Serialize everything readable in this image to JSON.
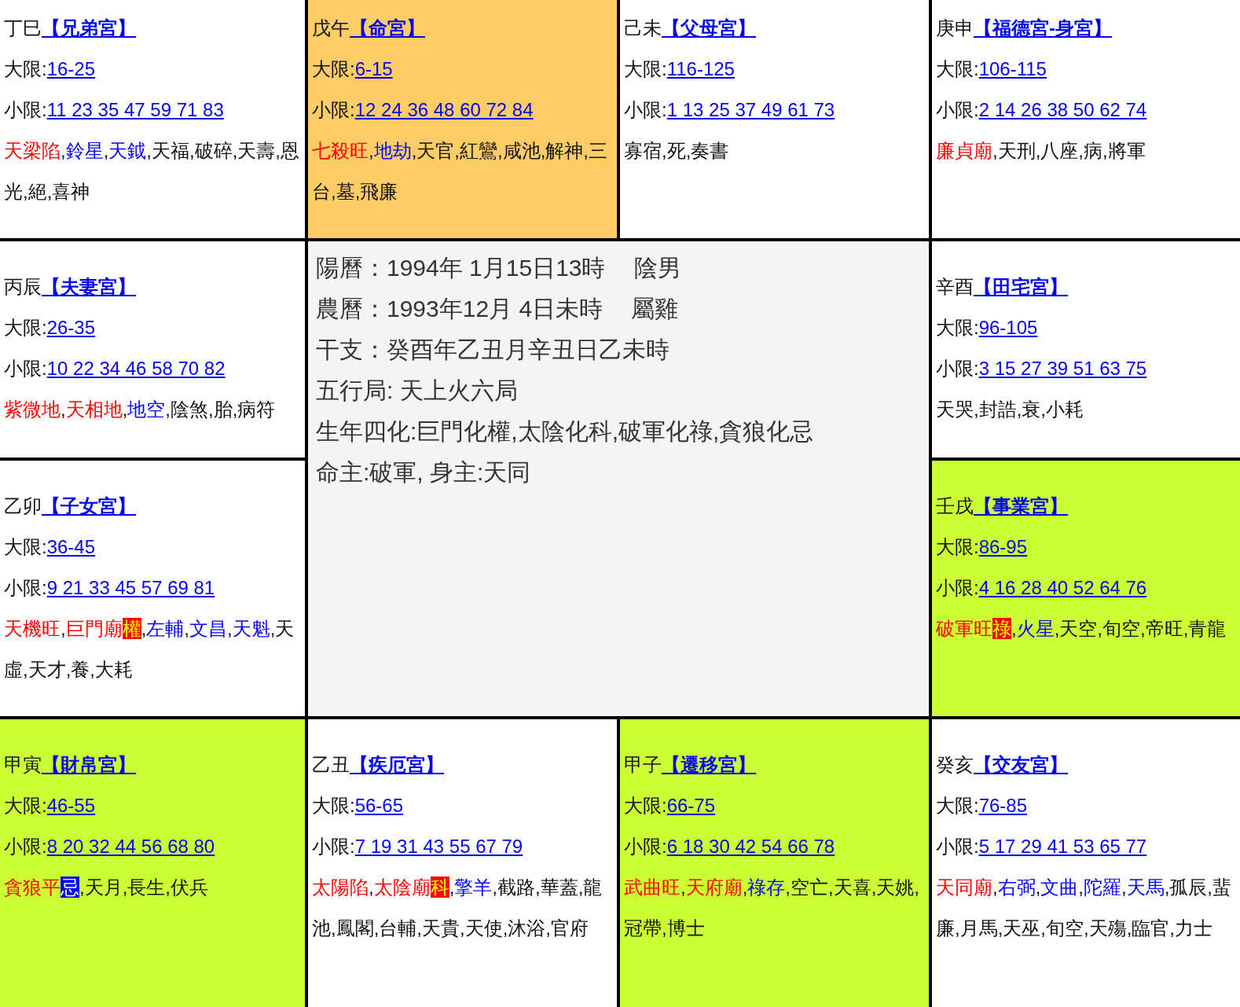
{
  "separator": ",",
  "palaces": [
    {
      "stem": "丁巳",
      "name": "【兄弟宮】",
      "color": "#ffffff",
      "major_limit": {
        "label": "大限:",
        "value": "16-25"
      },
      "minor_limit": {
        "label": "小限:",
        "value": "11 23 35 47 59 71 83"
      },
      "stars": [
        {
          "name": "天梁陷",
          "kind": "major"
        },
        {
          "name": "鈴星",
          "kind": "minor"
        },
        {
          "name": "天鉞",
          "kind": "minor"
        },
        {
          "name": "天福",
          "kind": "other"
        },
        {
          "name": "破碎",
          "kind": "other"
        },
        {
          "name": "天壽",
          "kind": "other"
        },
        {
          "name": "恩光",
          "kind": "other"
        },
        {
          "name": "絕",
          "kind": "other"
        },
        {
          "name": "喜神",
          "kind": "other"
        }
      ]
    },
    {
      "stem": "戊午",
      "name": "【命宮】",
      "color": "#ffcc66",
      "major_limit": {
        "label": "大限:",
        "value": "6-15"
      },
      "minor_limit": {
        "label": "小限:",
        "value": "12 24 36 48 60 72 84"
      },
      "stars": [
        {
          "name": "七殺旺",
          "kind": "major"
        },
        {
          "name": "地劫",
          "kind": "minor"
        },
        {
          "name": "天官",
          "kind": "other"
        },
        {
          "name": "紅鸞",
          "kind": "other"
        },
        {
          "name": "咸池",
          "kind": "other"
        },
        {
          "name": "解神",
          "kind": "other"
        },
        {
          "name": "三台",
          "kind": "other"
        },
        {
          "name": "墓",
          "kind": "other"
        },
        {
          "name": "飛廉",
          "kind": "other"
        }
      ]
    },
    {
      "stem": "己未",
      "name": "【父母宮】",
      "color": "#ffffff",
      "major_limit": {
        "label": "大限:",
        "value": "116-125"
      },
      "minor_limit": {
        "label": "小限:",
        "value": "1 13 25 37 49 61 73"
      },
      "stars": [
        {
          "name": "寡宿",
          "kind": "other"
        },
        {
          "name": "死",
          "kind": "other"
        },
        {
          "name": "奏書",
          "kind": "other"
        }
      ]
    },
    {
      "stem": "庚申",
      "name": "【福德宮-身宮】",
      "color": "#ffffff",
      "major_limit": {
        "label": "大限:",
        "value": "106-115"
      },
      "minor_limit": {
        "label": "小限:",
        "value": "2 14 26 38 50 62 74"
      },
      "stars": [
        {
          "name": "廉貞廟",
          "kind": "major"
        },
        {
          "name": "天刑",
          "kind": "other"
        },
        {
          "name": "八座",
          "kind": "other"
        },
        {
          "name": "病",
          "kind": "other"
        },
        {
          "name": "將軍",
          "kind": "other"
        }
      ]
    },
    {
      "stem": "丙辰",
      "name": "【夫妻宮】",
      "color": "#ffffff",
      "major_limit": {
        "label": "大限:",
        "value": "26-35"
      },
      "minor_limit": {
        "label": "小限:",
        "value": "10 22 34 46 58 70 82"
      },
      "stars": [
        {
          "name": "紫微地",
          "kind": "major"
        },
        {
          "name": "天相地",
          "kind": "major"
        },
        {
          "name": "地空",
          "kind": "minor"
        },
        {
          "name": "陰煞",
          "kind": "other"
        },
        {
          "name": "胎",
          "kind": "other"
        },
        {
          "name": "病符",
          "kind": "other"
        }
      ]
    },
    {
      "stem": "辛酉",
      "name": "【田宅宮】",
      "color": "#ffffff",
      "major_limit": {
        "label": "大限:",
        "value": "96-105"
      },
      "minor_limit": {
        "label": "小限:",
        "value": "3 15 27 39 51 63 75"
      },
      "stars": [
        {
          "name": "天哭",
          "kind": "other"
        },
        {
          "name": "封誥",
          "kind": "other"
        },
        {
          "name": "衰",
          "kind": "other"
        },
        {
          "name": "小耗",
          "kind": "other"
        }
      ]
    },
    {
      "stem": "乙卯",
      "name": "【子女宮】",
      "color": "#ffffff",
      "major_limit": {
        "label": "大限:",
        "value": "36-45"
      },
      "minor_limit": {
        "label": "小限:",
        "value": "9 21 33 45 57 69 81"
      },
      "stars": [
        {
          "name": "天機旺",
          "kind": "major"
        },
        {
          "name": "巨門廟",
          "kind": "major",
          "hua": {
            "text": "權",
            "kind": "auspicious"
          }
        },
        {
          "name": "左輔",
          "kind": "minor"
        },
        {
          "name": "文昌",
          "kind": "minor"
        },
        {
          "name": "天魁",
          "kind": "minor"
        },
        {
          "name": "天虛",
          "kind": "other"
        },
        {
          "name": "天才",
          "kind": "other"
        },
        {
          "name": "養",
          "kind": "other"
        },
        {
          "name": "大耗",
          "kind": "other"
        }
      ]
    },
    {
      "stem": "壬戌",
      "name": "【事業宮】",
      "color": "#ccff33",
      "major_limit": {
        "label": "大限:",
        "value": "86-95"
      },
      "minor_limit": {
        "label": "小限:",
        "value": "4 16 28 40 52 64 76"
      },
      "stars": [
        {
          "name": "破軍旺",
          "kind": "major",
          "hua": {
            "text": "祿",
            "kind": "auspicious"
          }
        },
        {
          "name": "火星",
          "kind": "minor"
        },
        {
          "name": "天空",
          "kind": "other"
        },
        {
          "name": "旬空",
          "kind": "other"
        },
        {
          "name": "帝旺",
          "kind": "other"
        },
        {
          "name": "青龍",
          "kind": "other"
        }
      ]
    },
    {
      "stem": "甲寅",
      "name": "【財帛宮】",
      "color": "#ccff33",
      "major_limit": {
        "label": "大限:",
        "value": "46-55"
      },
      "minor_limit": {
        "label": "小限:",
        "value": "8 20 32 44 56 68 80"
      },
      "stars": [
        {
          "name": "貪狼平",
          "kind": "major",
          "hua": {
            "text": "忌",
            "kind": "adverse"
          }
        },
        {
          "name": "天月",
          "kind": "other"
        },
        {
          "name": "長生",
          "kind": "other"
        },
        {
          "name": "伏兵",
          "kind": "other"
        }
      ]
    },
    {
      "stem": "乙丑",
      "name": "【疾厄宮】",
      "color": "#ffffff",
      "major_limit": {
        "label": "大限:",
        "value": "56-65"
      },
      "minor_limit": {
        "label": "小限:",
        "value": "7 19 31 43 55 67 79"
      },
      "stars": [
        {
          "name": "太陽陷",
          "kind": "major"
        },
        {
          "name": "太陰廟",
          "kind": "major",
          "hua": {
            "text": "科",
            "kind": "auspicious"
          }
        },
        {
          "name": "擎羊",
          "kind": "minor"
        },
        {
          "name": "截路",
          "kind": "other"
        },
        {
          "name": "華蓋",
          "kind": "other"
        },
        {
          "name": "龍池",
          "kind": "other"
        },
        {
          "name": "鳳閣",
          "kind": "other"
        },
        {
          "name": "台輔",
          "kind": "other"
        },
        {
          "name": "天貴",
          "kind": "other"
        },
        {
          "name": "天使",
          "kind": "other"
        },
        {
          "name": "沐浴",
          "kind": "other"
        },
        {
          "name": "官府",
          "kind": "other"
        }
      ]
    },
    {
      "stem": "甲子",
      "name": "【遷移宮】",
      "color": "#ccff33",
      "major_limit": {
        "label": "大限:",
        "value": "66-75"
      },
      "minor_limit": {
        "label": "小限:",
        "value": "6 18 30 42 54 66 78"
      },
      "stars": [
        {
          "name": "武曲旺",
          "kind": "major"
        },
        {
          "name": "天府廟",
          "kind": "major"
        },
        {
          "name": "祿存",
          "kind": "minor"
        },
        {
          "name": "空亡",
          "kind": "other"
        },
        {
          "name": "天喜",
          "kind": "other"
        },
        {
          "name": "天姚",
          "kind": "other"
        },
        {
          "name": "冠帶",
          "kind": "other"
        },
        {
          "name": "博士",
          "kind": "other"
        }
      ]
    },
    {
      "stem": "癸亥",
      "name": "【交友宮】",
      "color": "#ffffff",
      "major_limit": {
        "label": "大限:",
        "value": "76-85"
      },
      "minor_limit": {
        "label": "小限:",
        "value": "5 17 29 41 53 65 77"
      },
      "stars": [
        {
          "name": "天同廟",
          "kind": "major"
        },
        {
          "name": "右弼",
          "kind": "minor"
        },
        {
          "name": "文曲",
          "kind": "minor"
        },
        {
          "name": "陀羅",
          "kind": "minor"
        },
        {
          "name": "天馬",
          "kind": "minor"
        },
        {
          "name": "孤辰",
          "kind": "other"
        },
        {
          "name": "蜚廉",
          "kind": "other"
        },
        {
          "name": "月馬",
          "kind": "other"
        },
        {
          "name": "天巫",
          "kind": "other"
        },
        {
          "name": "旬空",
          "kind": "other"
        },
        {
          "name": "天殤",
          "kind": "other"
        },
        {
          "name": "臨官",
          "kind": "other"
        },
        {
          "name": "力士",
          "kind": "other"
        }
      ]
    }
  ],
  "center": [
    {
      "text": "陽曆：1994年 1月15日13時",
      "extra": "陰男"
    },
    {
      "text": "農曆：1993年12月 4日未時",
      "extra": "屬雞"
    },
    {
      "text": "干支：癸酉年乙丑月辛丑日乙未時"
    },
    {
      "text": "五行局: 天上火六局"
    },
    {
      "text": "生年四化:巨門化權,太陰化科,破軍化祿,貪狼化忌"
    },
    {
      "text": "命主:破軍, 身主:天同"
    }
  ]
}
